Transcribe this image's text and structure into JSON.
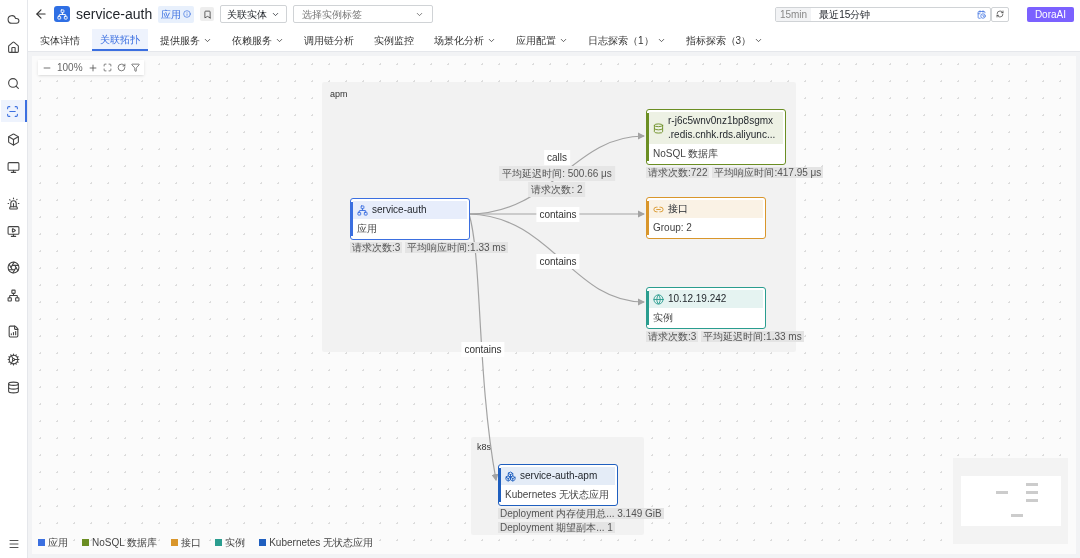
{
  "sidebar_items": [
    {
      "selected": false
    },
    {
      "selected": false
    },
    {
      "selected": false
    },
    {
      "selected": true
    },
    {
      "selected": false
    },
    {
      "selected": false
    },
    {
      "selected": false
    },
    {
      "selected": false
    },
    {
      "selected": false
    },
    {
      "selected": false
    },
    {
      "selected": false
    },
    {
      "selected": false
    },
    {
      "selected": false
    }
  ],
  "header": {
    "title": "service-auth",
    "badge": "应用",
    "entity_select": "关联实体",
    "tag_select_placeholder": "选择实例标签",
    "time_preset": "15min",
    "time_range": "最近15分钟",
    "ai_button": "DoraAI"
  },
  "tabs": [
    {
      "label": "实体详情",
      "selected": false,
      "has_menu": false
    },
    {
      "label": "关联拓扑",
      "selected": true,
      "has_menu": false
    },
    {
      "label": "提供服务",
      "selected": false,
      "has_menu": true
    },
    {
      "label": "依赖服务",
      "selected": false,
      "has_menu": true
    },
    {
      "label": "调用链分析",
      "selected": false,
      "has_menu": false
    },
    {
      "label": "实例监控",
      "selected": false,
      "has_menu": false
    },
    {
      "label": "场景化分析",
      "selected": false,
      "has_menu": true
    },
    {
      "label": "应用配置",
      "selected": false,
      "has_menu": true
    },
    {
      "label": "日志探索（1）",
      "selected": false,
      "has_menu": true
    },
    {
      "label": "指标探索（3）",
      "selected": false,
      "has_menu": true
    }
  ],
  "toolbar": {
    "zoom": "100%"
  },
  "groups": [
    {
      "label": "apm"
    },
    {
      "label": "k8s"
    }
  ],
  "nodes": [
    {
      "kind": "app",
      "title_lines": [
        "service-auth"
      ],
      "subtitle": "应用",
      "color": "#3b6fe0",
      "metrics": [
        "请求次数:3",
        "平均响应时间:1.33 ms"
      ]
    },
    {
      "kind": "nosql",
      "title_lines": [
        "r-j6c5wnv0nz1bp8sgmx",
        ".redis.cnhk.rds.aliyunc..."
      ],
      "subtitle": "NoSQL 数据库",
      "color": "#6b8e23",
      "metrics": [
        "请求次数:722",
        "平均响应时间:417.95 μs"
      ]
    },
    {
      "kind": "interface",
      "title_lines": [
        "接口"
      ],
      "subtitle": "Group: 2",
      "color": "#d9962b"
    },
    {
      "kind": "instance",
      "title_lines": [
        "10.12.19.242"
      ],
      "subtitle": "实例",
      "color": "#2a9d8f",
      "metrics": [
        "请求次数:3",
        "平均延迟时间:1.33 ms"
      ]
    },
    {
      "kind": "k8s",
      "title_lines": [
        "service-auth-apm"
      ],
      "subtitle": "Kubernetes 无状态应用",
      "color": "#1f5fbf",
      "metrics": [
        "Deployment 内存使用总... 3.149 GiB",
        "Deployment 期望副本... 1"
      ]
    }
  ],
  "edges": [
    {
      "labels": [
        "calls",
        "平均延迟时间: 500.66 μs",
        "请求次数: 2"
      ]
    },
    {
      "labels": [
        "contains"
      ]
    },
    {
      "labels": [
        "contains"
      ]
    },
    {
      "labels": [
        "contains"
      ]
    }
  ],
  "legend": [
    {
      "label": "应用",
      "color": "#3b6fe0"
    },
    {
      "label": "NoSQL 数据库",
      "color": "#6b8e23"
    },
    {
      "label": "接口",
      "color": "#d9962b"
    },
    {
      "label": "实例",
      "color": "#2a9d8f"
    },
    {
      "label": "Kubernetes 无状态应用",
      "color": "#1f5fbf"
    }
  ]
}
